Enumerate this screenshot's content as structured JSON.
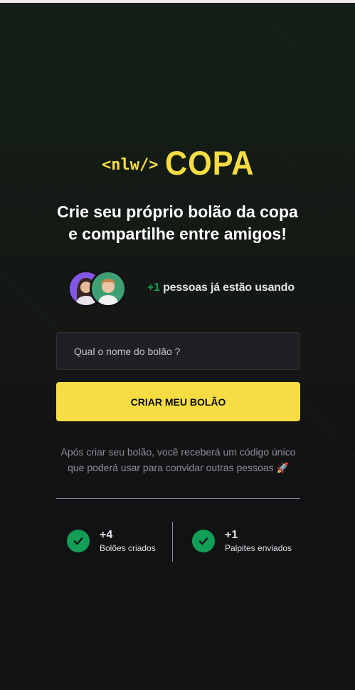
{
  "brand": {
    "code_tag": "<nlw/>",
    "name": "COPA",
    "color": "#F7DD43"
  },
  "hero": {
    "headline_line1": "Crie seu próprio bolão da copa",
    "headline_line2": "e compartilhe entre amigos!"
  },
  "users": {
    "count": "+1",
    "text": " pessoas já estão usando",
    "count_color": "#129E57"
  },
  "form": {
    "input_placeholder": "Qual o nome do bolão ?",
    "input_value": "",
    "button_label": "CRIAR MEU BOLÃO",
    "button_color": "#F7DD43"
  },
  "info": {
    "line1": "Após criar seu bolão, você receberá um código único",
    "line2": "que poderá usar para convidar outras pessoas 🚀"
  },
  "stats": [
    {
      "value": "+4",
      "label": "Bolões criados",
      "icon": "check-icon"
    },
    {
      "value": "+1",
      "label": "Palpites enviados",
      "icon": "check-icon"
    }
  ],
  "colors": {
    "background": "#121214",
    "input_background": "#202024",
    "muted_text": "#8D8D99",
    "success": "#129E57"
  }
}
